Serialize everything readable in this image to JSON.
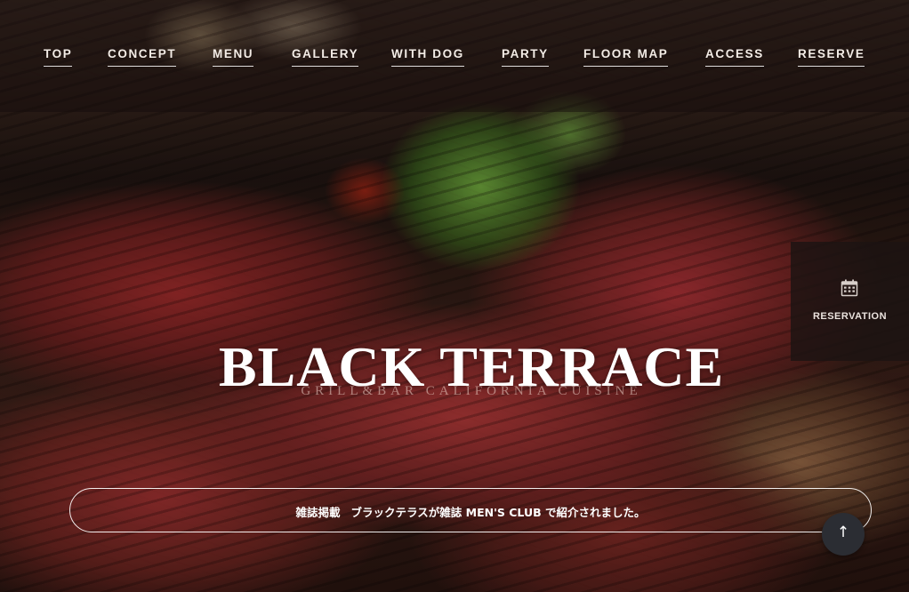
{
  "nav": {
    "items": [
      {
        "label": "TOP"
      },
      {
        "label": "CONCEPT"
      },
      {
        "label": "MENU"
      },
      {
        "label": "GALLERY"
      },
      {
        "label": "WITH DOG"
      },
      {
        "label": "PARTY"
      },
      {
        "label": "FLOOR MAP"
      },
      {
        "label": "ACCESS"
      },
      {
        "label": "RESERVE"
      }
    ]
  },
  "hero": {
    "title": "BLACK TERRACE",
    "subtitle": "GRILL&BAR CALIFORNIA CUISINE"
  },
  "reservation": {
    "label": "RESERVATION",
    "icon": "calendar-icon"
  },
  "news": {
    "label": "雑誌掲載",
    "text": "ブラックテラスが雑誌 MEN'S CLUB で紹介されました。"
  },
  "back_to_top": {
    "symbol": "↑",
    "icon": "arrow-up-icon"
  },
  "colors": {
    "nav_text": "#f3ece6",
    "reserve_bg": "#1c1412",
    "back_top_bg": "#2b2d33"
  }
}
